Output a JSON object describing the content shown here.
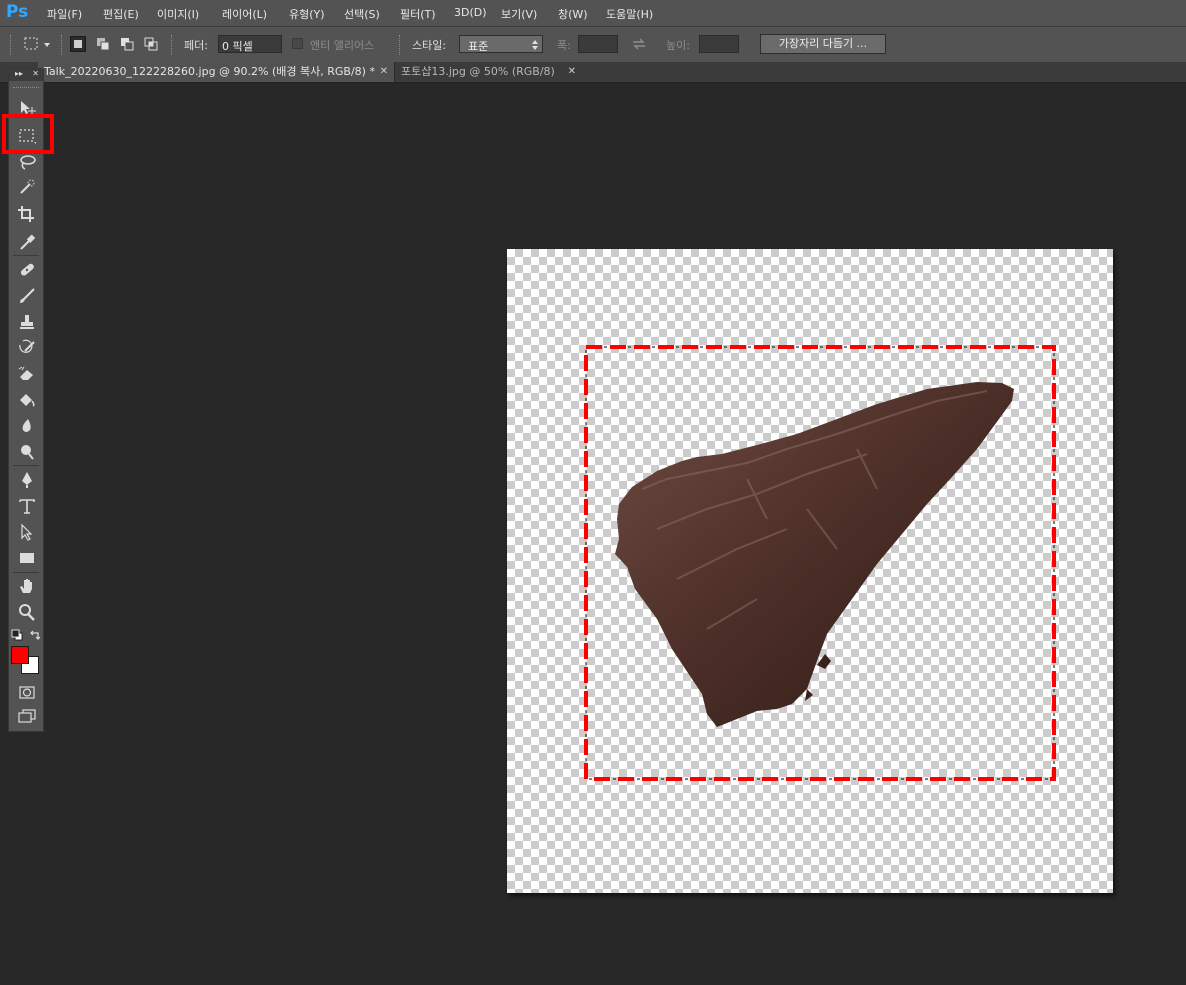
{
  "app": {
    "logo": "Ps"
  },
  "menu": [
    {
      "label": "파일(F)"
    },
    {
      "label": "편집(E)"
    },
    {
      "label": "이미지(I)"
    },
    {
      "label": "레이어(L)"
    },
    {
      "label": "유형(Y)"
    },
    {
      "label": "선택(S)"
    },
    {
      "label": "필터(T)"
    },
    {
      "label": "3D(D)"
    },
    {
      "label": "보기(V)"
    },
    {
      "label": "창(W)"
    },
    {
      "label": "도움말(H)"
    }
  ],
  "options": {
    "feather_label": "페더:",
    "feather_value": "0 픽셀",
    "antialias_label": "앤티 앨리어스",
    "style_label": "스타일:",
    "style_value": "표준",
    "width_label": "폭:",
    "height_label": "높이:",
    "refine_button": "가장자리 다듬기 ..."
  },
  "tabs": [
    {
      "label": "Talk_20220630_122228260.jpg @ 90.2% (배경 복사, RGB/8) *",
      "active": true
    },
    {
      "label": "포토샵13.jpg @ 50% (RGB/8)",
      "active": false
    }
  ],
  "toolbox": {
    "selected_tool": "rectangular-marquee-tool",
    "foreground_color": "#ff0000",
    "background_color": "#ffffff",
    "tools": [
      "move-tool",
      "rectangular-marquee-tool",
      "lasso-tool",
      "quick-selection-tool",
      "crop-tool",
      "eyedropper-tool",
      "healing-brush-tool",
      "brush-tool",
      "clone-stamp-tool",
      "history-brush-tool",
      "eraser-tool",
      "paint-bucket-tool",
      "blur-tool",
      "dodge-tool",
      "pen-tool",
      "type-tool",
      "path-selection-tool",
      "rectangle-tool",
      "hand-tool",
      "zoom-tool"
    ]
  },
  "annotation": {
    "color": "#ff0000"
  }
}
